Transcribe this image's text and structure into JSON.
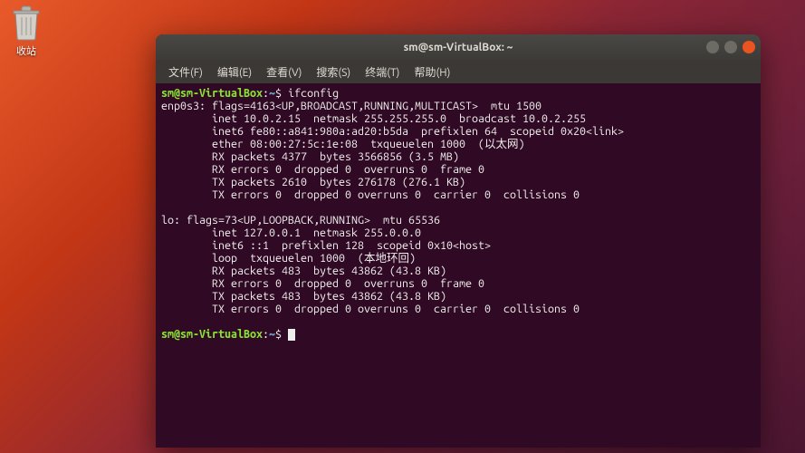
{
  "desktop": {
    "trash_label": "收站"
  },
  "window": {
    "title": "sm@sm-VirtualBox: ~"
  },
  "menubar": {
    "items": [
      "文件(F)",
      "编辑(E)",
      "查看(V)",
      "搜索(S)",
      "终端(T)",
      "帮助(H)"
    ]
  },
  "prompt": {
    "user_host": "sm@sm-VirtualBox",
    "sep": ":",
    "path": "~",
    "end": "$ "
  },
  "terminal": {
    "command1": "ifconfig",
    "lines": [
      "enp0s3: flags=4163<UP,BROADCAST,RUNNING,MULTICAST>  mtu 1500",
      "        inet 10.0.2.15  netmask 255.255.255.0  broadcast 10.0.2.255",
      "        inet6 fe80::a841:980a:ad20:b5da  prefixlen 64  scopeid 0x20<link>",
      "        ether 08:00:27:5c:1e:08  txqueuelen 1000  (以太网)",
      "        RX packets 4377  bytes 3566856 (3.5 MB)",
      "        RX errors 0  dropped 0  overruns 0  frame 0",
      "        TX packets 2610  bytes 276178 (276.1 KB)",
      "        TX errors 0  dropped 0 overruns 0  carrier 0  collisions 0",
      "",
      "lo: flags=73<UP,LOOPBACK,RUNNING>  mtu 65536",
      "        inet 127.0.0.1  netmask 255.0.0.0",
      "        inet6 ::1  prefixlen 128  scopeid 0x10<host>",
      "        loop  txqueuelen 1000  (本地环回)",
      "        RX packets 483  bytes 43862 (43.8 KB)",
      "        RX errors 0  dropped 0  overruns 0  frame 0",
      "        TX packets 483  bytes 43862 (43.8 KB)",
      "        TX errors 0  dropped 0 overruns 0  carrier 0  collisions 0",
      ""
    ]
  }
}
